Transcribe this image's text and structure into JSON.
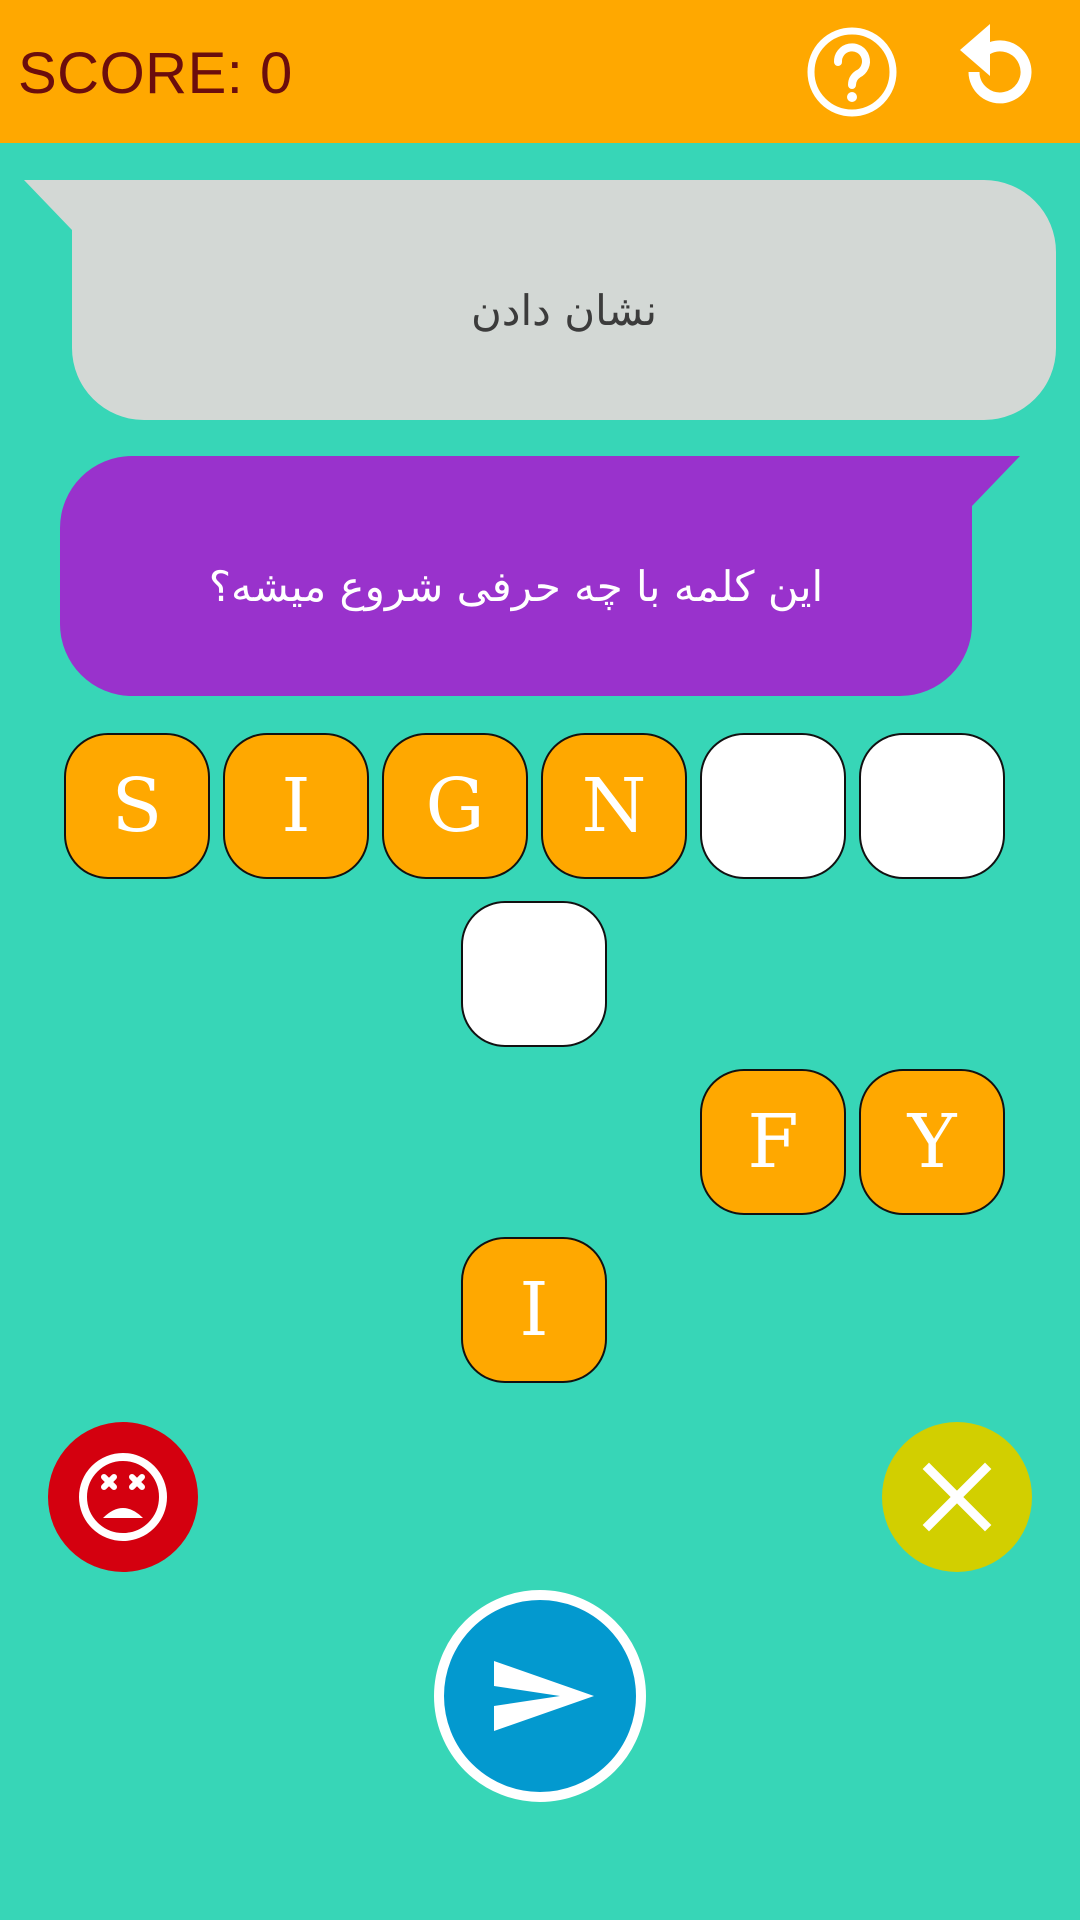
{
  "header": {
    "score_text": "SCORE: 0",
    "help_icon": "question-circle-icon",
    "restart_icon": "restart-arrow-icon"
  },
  "word_bubble": {
    "text": "نشان دادن"
  },
  "question_bubble": {
    "text": "این کلمه با چه حرفی شروع میشه؟"
  },
  "answer_slots": [
    {
      "letter": "S",
      "state": "filled"
    },
    {
      "letter": "I",
      "state": "filled"
    },
    {
      "letter": "G",
      "state": "filled"
    },
    {
      "letter": "N",
      "state": "filled"
    },
    {
      "letter": "",
      "state": "empty"
    },
    {
      "letter": "",
      "state": "empty"
    },
    {
      "letter": "",
      "state": "empty"
    }
  ],
  "letter_choices": [
    {
      "letter": "F"
    },
    {
      "letter": "Y"
    },
    {
      "letter": "I"
    }
  ],
  "buttons": {
    "give_up_icon": "dead-face-icon",
    "clear_icon": "close-x-icon",
    "send_icon": "send-arrow-icon"
  },
  "colors": {
    "background": "#37d6b7",
    "header": "#ffa800",
    "score_text": "#6b0d0d",
    "word_bubble": "#d3d8d5",
    "question_bubble": "#9932cc",
    "tile_filled": "#ffa800",
    "tile_empty": "#ffffff",
    "give_up": "#d4000f",
    "clear": "#d2cf00",
    "send": "#0399cf"
  }
}
